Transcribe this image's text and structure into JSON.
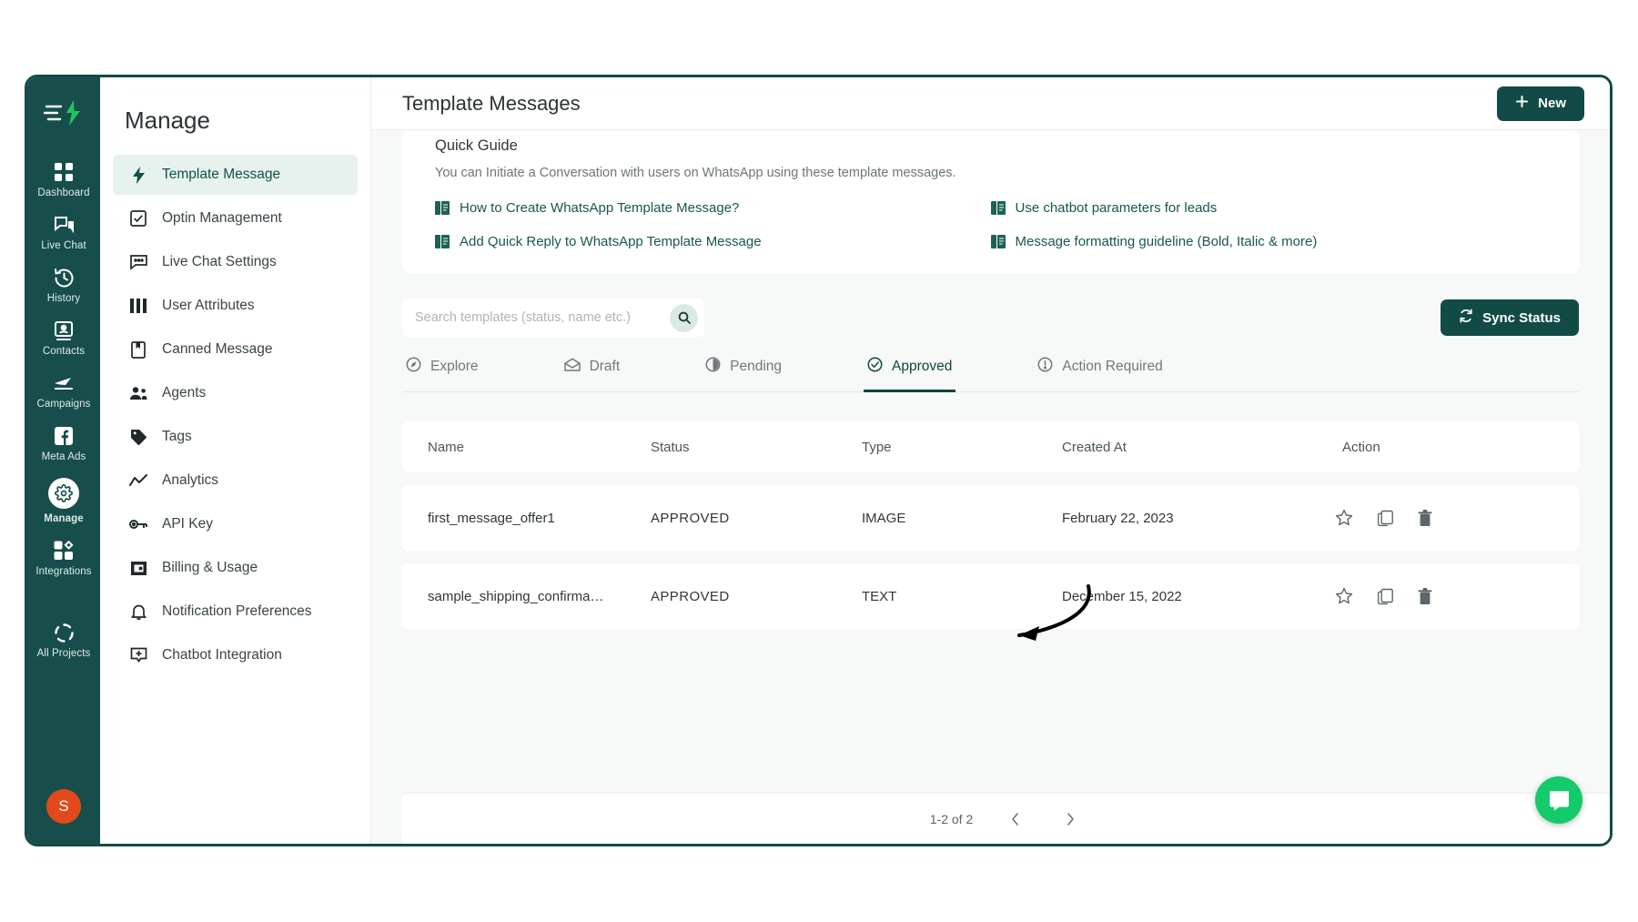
{
  "colors": {
    "brand_dark": "#124b45",
    "sidebar_bg": "#174e4b",
    "accent_green": "#13cb69",
    "status_approved": "#4f9a51",
    "avatar_bg": "#e24a1b",
    "active_item_bg": "#e7f2ef"
  },
  "primary_sidebar": {
    "logo_icon": "lightning-list-logo-icon",
    "items": [
      {
        "label": "Dashboard",
        "icon": "dashboard-grid-icon",
        "active": false
      },
      {
        "label": "Live Chat",
        "icon": "chat-bubbles-icon",
        "active": false
      },
      {
        "label": "History",
        "icon": "clock-history-icon",
        "active": false
      },
      {
        "label": "Contacts",
        "icon": "contact-card-icon",
        "active": false
      },
      {
        "label": "Campaigns",
        "icon": "paper-plane-icon",
        "active": false
      },
      {
        "label": "Meta Ads",
        "icon": "facebook-icon",
        "active": false
      },
      {
        "label": "Manage",
        "icon": "gear-icon",
        "active": true
      },
      {
        "label": "Integrations",
        "icon": "integrations-blocks-icon",
        "active": false
      },
      {
        "label": "All Projects",
        "icon": "projects-circle-icon",
        "active": false
      }
    ],
    "avatar_initial": "S"
  },
  "manage_panel": {
    "title": "Manage",
    "items": [
      {
        "label": "Template Message",
        "icon": "lightning-bolt-icon",
        "active": true
      },
      {
        "label": "Optin Management",
        "icon": "checkbox-icon",
        "active": false
      },
      {
        "label": "Live Chat Settings",
        "icon": "chat-dots-icon",
        "active": false
      },
      {
        "label": "User Attributes",
        "icon": "columns-icon",
        "active": false
      },
      {
        "label": "Canned Message",
        "icon": "bookmark-page-icon",
        "active": false
      },
      {
        "label": "Agents",
        "icon": "people-icon",
        "active": false
      },
      {
        "label": "Tags",
        "icon": "tag-icon",
        "active": false
      },
      {
        "label": "Analytics",
        "icon": "trend-line-icon",
        "active": false
      },
      {
        "label": "API Key",
        "icon": "key-icon",
        "active": false
      },
      {
        "label": "Billing & Usage",
        "icon": "wallet-icon",
        "active": false
      },
      {
        "label": "Notification Preferences",
        "icon": "bell-icon",
        "active": false
      },
      {
        "label": "Chatbot Integration",
        "icon": "chat-plus-icon",
        "active": false
      }
    ]
  },
  "topbar": {
    "page_title": "Template Messages",
    "new_button_label": "New",
    "new_button_icon": "plus-icon"
  },
  "quick_guide": {
    "title": "Quick Guide",
    "subtitle": "You can Initiate a Conversation with users on WhatsApp using these template messages.",
    "links": [
      {
        "label": "How to Create WhatsApp Template Message?",
        "icon": "book-icon"
      },
      {
        "label": "Use chatbot parameters for leads",
        "icon": "book-icon"
      },
      {
        "label": "Add Quick Reply to WhatsApp Template Message",
        "icon": "book-icon"
      },
      {
        "label": "Message formatting guideline (Bold, Italic & more)",
        "icon": "book-icon"
      }
    ]
  },
  "search": {
    "placeholder": "Search templates (status, name etc.)",
    "value": "",
    "icon": "search-icon"
  },
  "sync": {
    "label": "Sync Status",
    "icon": "refresh-icon"
  },
  "tabs": [
    {
      "label": "Explore",
      "icon": "compass-icon",
      "active": false
    },
    {
      "label": "Draft",
      "icon": "envelope-icon",
      "active": false
    },
    {
      "label": "Pending",
      "icon": "half-circle-icon",
      "active": false
    },
    {
      "label": "Approved",
      "icon": "check-circle-icon",
      "active": true
    },
    {
      "label": "Action Required",
      "icon": "alert-circle-icon",
      "active": false
    }
  ],
  "table": {
    "headers": [
      "Name",
      "Status",
      "Type",
      "Created At",
      "Action"
    ],
    "rows": [
      {
        "name": "first_message_offer1",
        "status": "APPROVED",
        "type": "IMAGE",
        "created_at": "February 22, 2023",
        "actions": [
          "star-icon",
          "copy-icon",
          "trash-icon"
        ]
      },
      {
        "name": "sample_shipping_confirma…",
        "status": "APPROVED",
        "type": "TEXT",
        "created_at": "December 15, 2022",
        "actions": [
          "star-icon",
          "copy-icon",
          "trash-icon"
        ]
      }
    ]
  },
  "footer": {
    "page_count": "1-2 of 2",
    "prev_icon": "chevron-left-icon",
    "next_icon": "chevron-right-icon"
  },
  "chat_widget": {
    "icon": "intercom-chat-icon"
  },
  "annotation": {
    "shape": "curved-arrow",
    "points_at": "status-cell-approved"
  }
}
